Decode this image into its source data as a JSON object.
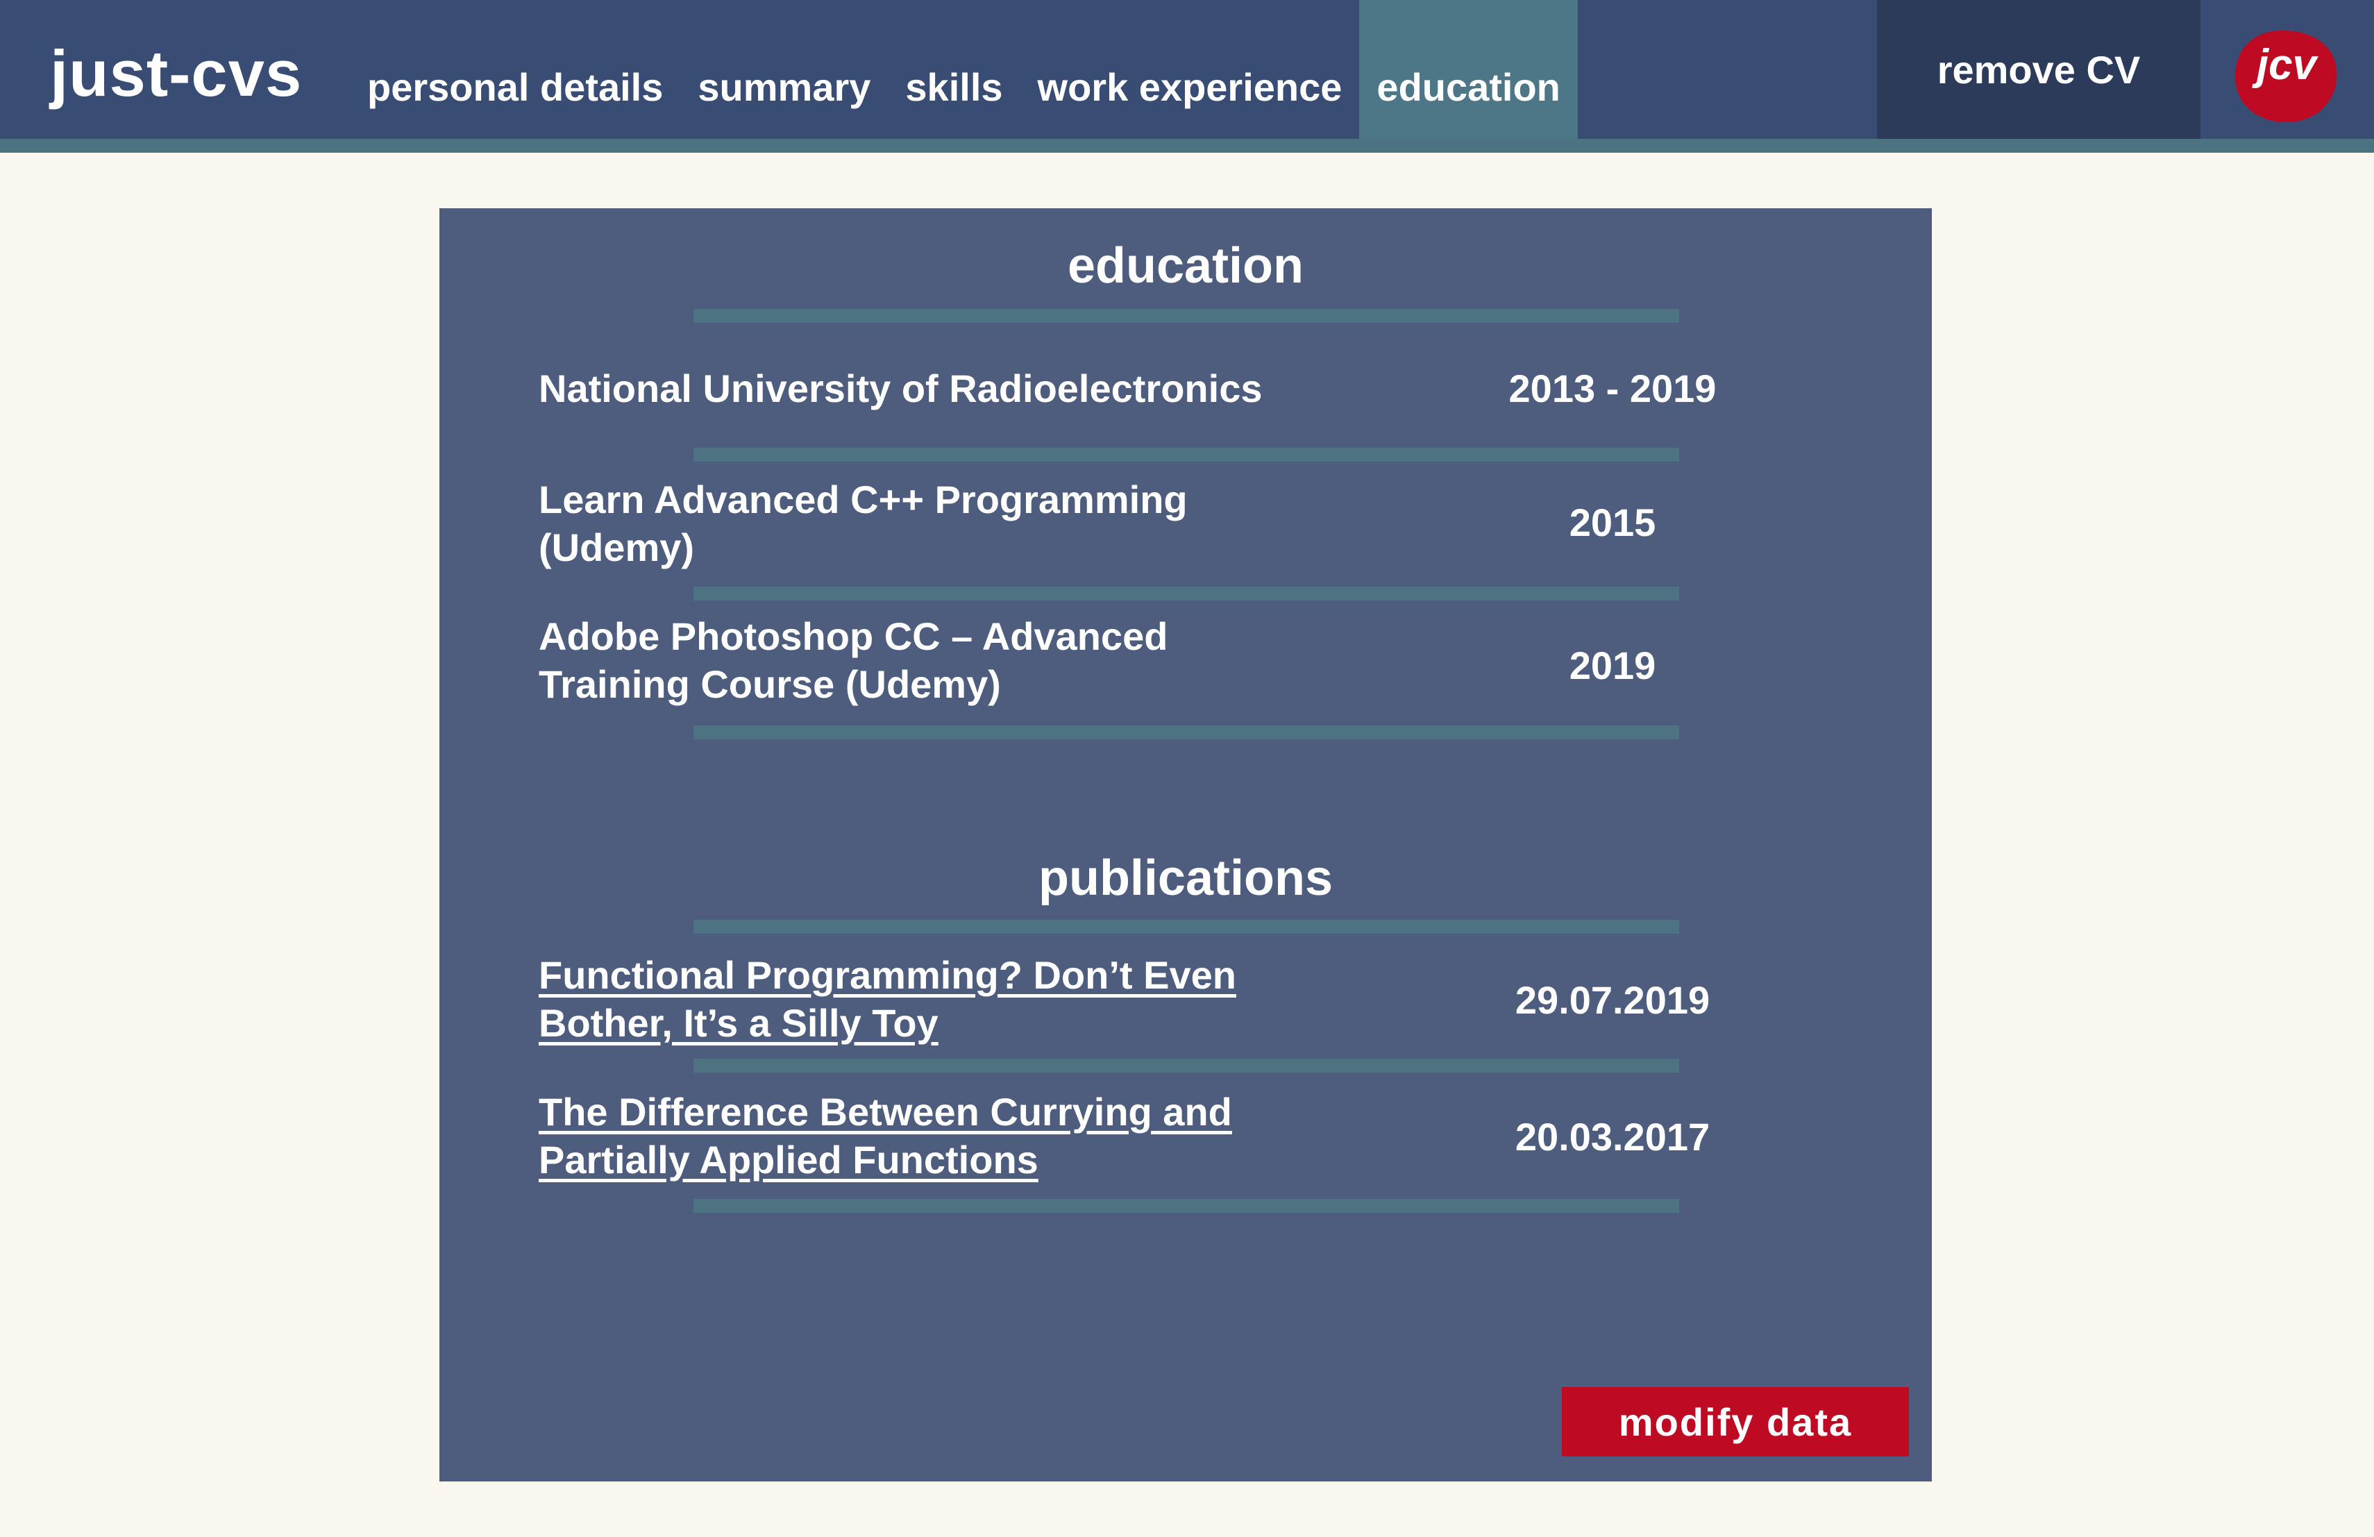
{
  "app": {
    "name": "just-cvs"
  },
  "nav": {
    "items": [
      {
        "label": "personal details"
      },
      {
        "label": "summary"
      },
      {
        "label": "skills"
      },
      {
        "label": "work experience"
      },
      {
        "label": "education",
        "active": true
      }
    ]
  },
  "header": {
    "remove_label": "remove CV",
    "badge_text": "jcv"
  },
  "education": {
    "title": "education",
    "entries": [
      {
        "name_lines": [
          "National University of Radioelectronics"
        ],
        "dates": "2013 - 2019"
      },
      {
        "name_lines": [
          "Learn Advanced C++ Programming",
          "(Udemy)"
        ],
        "dates": "2015"
      },
      {
        "name_lines": [
          "Adobe Photoshop CC – Advanced",
          "Training Course (Udemy)"
        ],
        "dates": "2019"
      }
    ]
  },
  "publications": {
    "title": "publications",
    "entries": [
      {
        "title_lines": [
          "Functional Programming? Don’t Even",
          "Bother, It’s a Silly Toy"
        ],
        "date": "29.07.2019"
      },
      {
        "title_lines": [
          "The Difference Between Currying and",
          "Partially Applied Functions"
        ],
        "date": "20.03.2017"
      }
    ]
  },
  "actions": {
    "modify_label": "modify data"
  },
  "colors": {
    "background": "#faf8ee",
    "topbar": "#394d74",
    "accent_teal": "#4d7383",
    "card": "#4e5d7d",
    "brand_red": "#be0a23",
    "remove_bg": "#2c3b59"
  },
  "icons": {
    "badge": "jcv-logo-badge"
  }
}
